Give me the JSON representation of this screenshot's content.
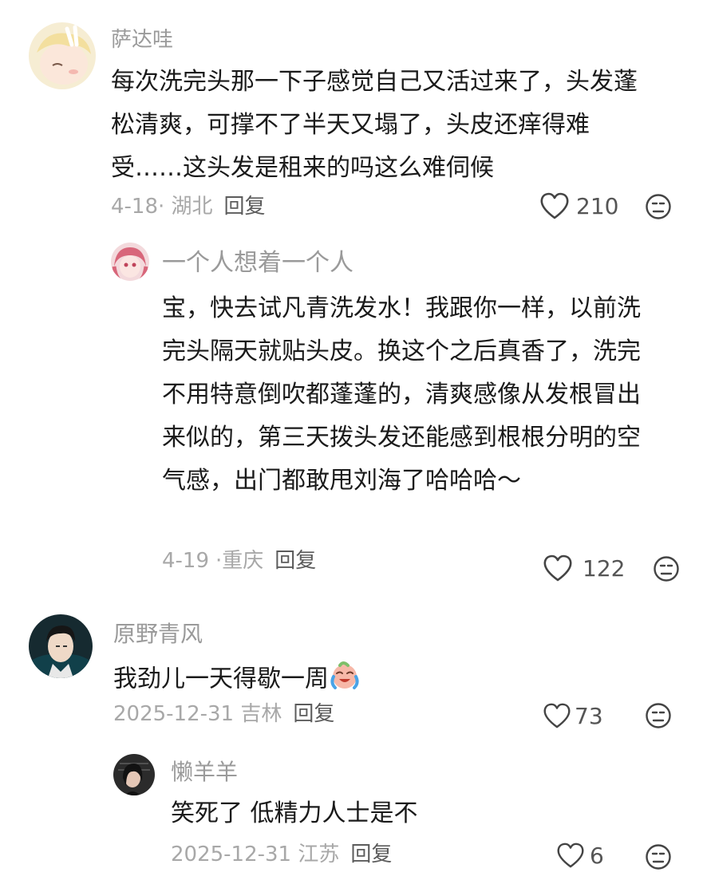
{
  "comments": [
    {
      "username": "萨达哇",
      "text": "每次洗完头那一下子感觉自己又活过来了，头发蓬松清爽，可撑不了半天又塌了，头皮还痒得难受……这头发是租来的吗这么难伺候",
      "date": "4-18",
      "location": "· 湖北",
      "reply_label": "回复",
      "likes": "210"
    },
    {
      "username": "一个人想着一个人",
      "text": "宝，快去试凡青洗发水！我跟你一样，以前洗完头隔天就贴头皮。换这个之后真香了，洗完不用特意倒吹都蓬蓬的，清爽感像从发根冒出来似的，第三天拨头发还能感到根根分明的空气感，出门都敢甩刘海了哈哈哈～",
      "date": "4-19",
      "location": "·重庆",
      "reply_label": "回复",
      "likes": "122"
    },
    {
      "username": "原野青风",
      "text": "我劲儿一天得歇一周",
      "emoji": "crying-laughing-face",
      "date": "2025-12-31",
      "location": "吉林",
      "reply_label": "回复",
      "likes": "73"
    },
    {
      "username": "懒羊羊",
      "text": "笑死了 低精力人士是不",
      "date": "2025-12-31",
      "location": "江苏",
      "reply_label": "回复",
      "likes": "6"
    }
  ],
  "icons": {
    "like": "heart-outline-icon",
    "dislike": "unamused-face-icon"
  }
}
